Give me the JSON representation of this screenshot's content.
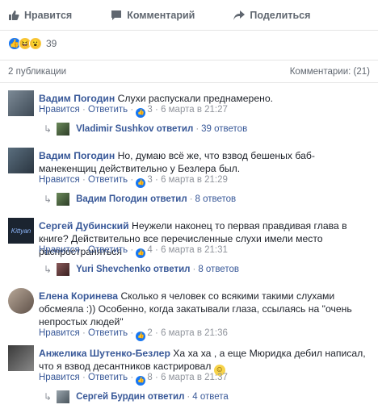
{
  "topbar": {
    "like_label": "Нравится",
    "comment_label": "Комментарий",
    "share_label": "Поделиться"
  },
  "reactions": {
    "count": "39"
  },
  "sharebar": {
    "publications": "2 публикации",
    "comments": "Комментарии: (21)"
  },
  "comments": [
    {
      "author": "Вадим Погодин",
      "text": "Слухи распускали преднамерено.",
      "like": "Нравится",
      "reply": "Ответить",
      "likes": "3",
      "time": "6 марта в 21:27",
      "thread": {
        "author": "Vladimir Sushkov ответил",
        "count": "39 ответов"
      }
    },
    {
      "author": "Вадим Погодин",
      "text": "Но, думаю всё же, что взвод бешеных баб-манекенщиц действительно у Безлера был.",
      "like": "Нравится",
      "reply": "Ответить",
      "likes": "3",
      "time": "6 марта в 21:29",
      "thread": {
        "author": "Вадим Погодин ответил",
        "count": "8 ответов"
      }
    },
    {
      "author": "Сергей Дубинский",
      "text": "Неужели наконец то первая правдивая глава в книге? Действительно все перечисленные слухи имели место распространяться",
      "like": "Нравится",
      "reply": "Ответить",
      "likes": "4",
      "time": "6 марта в 21:31",
      "thread": {
        "author": "Yuri Shevchenko ответил",
        "count": "8 ответов"
      }
    },
    {
      "author": "Елена Коринева",
      "text": "Сколько я человек со всякими такими слухами обсмеяла :)) Особенно, когда закатывали глаза, ссылаясь на \"очень непростых людей\"",
      "like": "Нравится",
      "reply": "Ответить",
      "likes": "2",
      "time": "6 марта в 21:36"
    },
    {
      "author": "Анжелика Шутенко-Безлер",
      "text": "Ха ха ха , а еще Мюридка дебил написал, что я взвод десантников кастрировал",
      "like": "Нравится",
      "reply": "Ответить",
      "likes": "8",
      "time": "6 марта в 21:37",
      "thread": {
        "author": "Сергей Бурдин ответил",
        "count": "4 ответа"
      }
    }
  ],
  "avatar3_text": "Kittyan",
  "dot": "·"
}
